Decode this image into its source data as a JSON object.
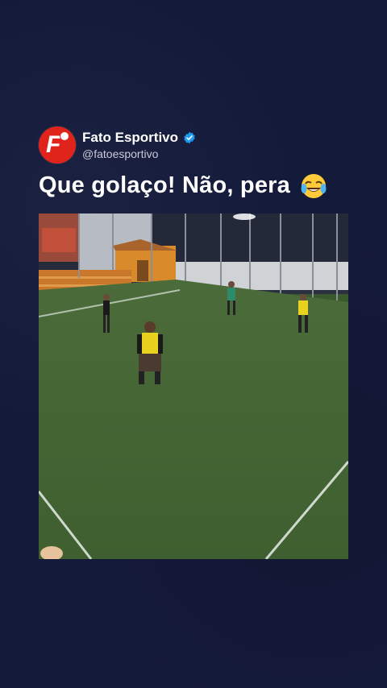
{
  "post": {
    "author_name": "Fato Esportivo",
    "author_handle": "@fatoesportivo",
    "verified": true,
    "avatar_letter": "F",
    "caption": "Que golaço! Não, pera",
    "caption_emoji": "face-with-tears-of-joy",
    "media_description_icon": "video-frame"
  },
  "colors": {
    "background": "#141a3a",
    "avatar_red": "#e0241b",
    "verified_blue": "#1d9bf0",
    "pitch_green": "#3f6431",
    "bib_yellow": "#e8d21f"
  }
}
